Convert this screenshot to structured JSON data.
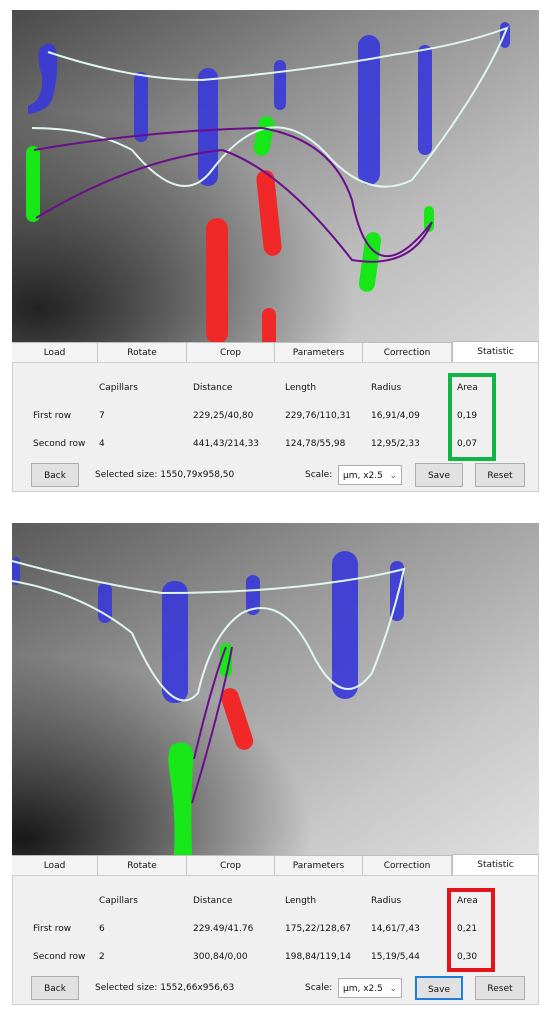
{
  "colors": {
    "blue_capillary": "#3a3ad8",
    "green_capillary": "#17e617",
    "red_capillary": "#f02828",
    "curve_light": "#dff5f0",
    "curve_purple": "#6a0f8a",
    "highlight_green": "#10b545",
    "highlight_red": "#e3141a",
    "focus_blue": "#1e7fd6"
  },
  "tabs": [
    "Load",
    "Rotate",
    "Crop",
    "Parameters",
    "Correction",
    "Statistic"
  ],
  "active_tab": "Statistic",
  "headers": {
    "capillars": "Capillars",
    "distance": "Distance",
    "length": "Length",
    "radius": "Radius",
    "area": "Area"
  },
  "panels": [
    {
      "rows": [
        {
          "label": "First row",
          "capillars": "7",
          "distance": "229,25/40,80",
          "length": "229,76/110,31",
          "radius": "16,91/4,09",
          "area": "0,19"
        },
        {
          "label": "Second row",
          "capillars": "4",
          "distance": "441,43/214,33",
          "length": "124,78/55,98",
          "radius": "12,95/2,33",
          "area": "0,07"
        }
      ],
      "back_label": "Back",
      "selected_size": "Selected size: 1550,79x958,50",
      "scale_label": "Scale:",
      "scale_value": "μm, x2.5",
      "save_label": "Save",
      "reset_label": "Reset",
      "area_highlight_color": "green"
    },
    {
      "rows": [
        {
          "label": "First row",
          "capillars": "6",
          "distance": "229.49/41.76",
          "length": "175,22/128,67",
          "radius": "14,61/7,43",
          "area": "0,21"
        },
        {
          "label": "Second row",
          "capillars": "2",
          "distance": "300,84/0,00",
          "length": "198,84/119,14",
          "radius": "15,19/5,44",
          "area": "0,30"
        }
      ],
      "back_label": "Back",
      "selected_size": "Selected size: 1552,66x956,63",
      "scale_label": "Scale:",
      "scale_value": "μm, x2.5",
      "save_label": "Save",
      "reset_label": "Reset",
      "area_highlight_color": "red"
    }
  ]
}
